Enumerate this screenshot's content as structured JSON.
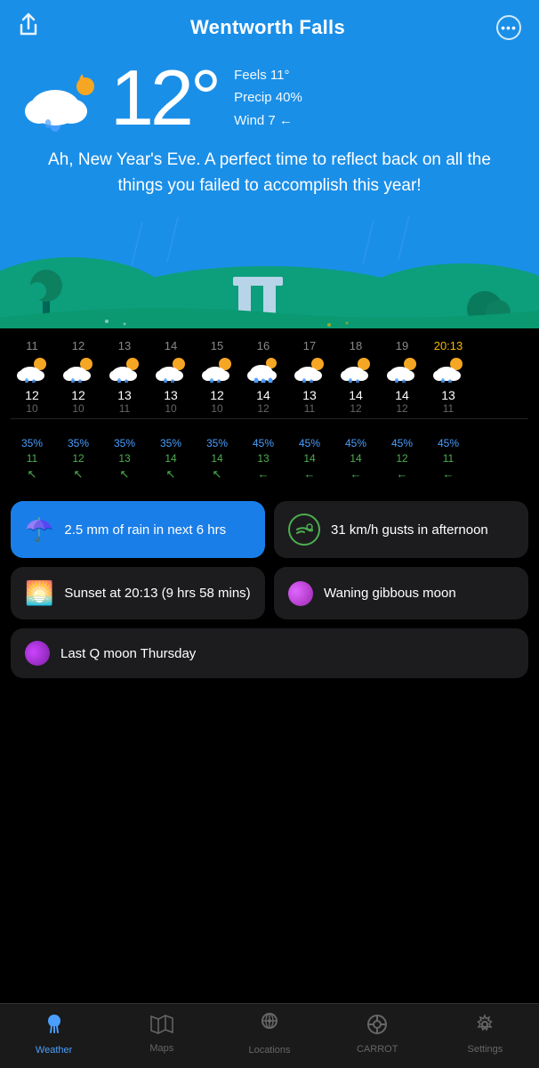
{
  "header": {
    "title": "Wentworth Falls",
    "share_label": "share",
    "more_label": "more"
  },
  "current": {
    "temperature": "12°",
    "feels_like": "Feels 11°",
    "precip": "Precip 40%",
    "wind": "Wind 7 ←",
    "message": "Ah, New Year's Eve. A perfect time to reflect back on all the things you failed to accomplish this year!"
  },
  "hourly": {
    "hours": [
      {
        "label": "11",
        "icon": "🌦",
        "high": "12",
        "low": "10"
      },
      {
        "label": "12",
        "icon": "🌦",
        "high": "12",
        "low": "10"
      },
      {
        "label": "13",
        "icon": "🌦",
        "high": "13",
        "low": "11"
      },
      {
        "label": "14",
        "icon": "🌦",
        "high": "13",
        "low": "10"
      },
      {
        "label": "15",
        "icon": "🌦",
        "high": "12",
        "low": "10"
      },
      {
        "label": "16",
        "icon": "🌧",
        "high": "14",
        "low": "12"
      },
      {
        "label": "17",
        "icon": "🌦",
        "high": "13",
        "low": "11"
      },
      {
        "label": "18",
        "icon": "🌦",
        "high": "14",
        "low": "12"
      },
      {
        "label": "19",
        "icon": "🌦",
        "high": "14",
        "low": "12"
      },
      {
        "label": "20",
        "icon": "🌦",
        "high": "13",
        "low": "11",
        "current": true,
        "current_label": "20:13"
      }
    ]
  },
  "details": [
    {
      "precip": "35%",
      "wind": "11",
      "dir": "↖"
    },
    {
      "precip": "35%",
      "wind": "12",
      "dir": "↖"
    },
    {
      "precip": "35%",
      "wind": "13",
      "dir": "↖"
    },
    {
      "precip": "35%",
      "wind": "14",
      "dir": "↖"
    },
    {
      "precip": "35%",
      "wind": "14",
      "dir": "↖"
    },
    {
      "precip": "45%",
      "wind": "13",
      "dir": "←"
    },
    {
      "precip": "45%",
      "wind": "14",
      "dir": "←"
    },
    {
      "precip": "45%",
      "wind": "14",
      "dir": "←"
    },
    {
      "precip": "45%",
      "wind": "12",
      "dir": "←"
    },
    {
      "precip": "45%",
      "wind": "11",
      "dir": "←"
    }
  ],
  "cards": [
    {
      "id": "rain",
      "icon": "☂️",
      "text": "2.5 mm of rain in next 6 hrs",
      "blue": true
    },
    {
      "id": "wind",
      "icon": "wind",
      "text": "31 km/h gusts in afternoon",
      "blue": false
    },
    {
      "id": "sunset",
      "icon": "🌅",
      "text": "Sunset at 20:13\n(9 hrs 58 mins)",
      "blue": false
    },
    {
      "id": "moon",
      "icon": "moon",
      "text": "Waning gibbous moon",
      "blue": false
    },
    {
      "id": "lastq",
      "icon": "lastq",
      "text": "Last Q moon Thursday",
      "blue": false,
      "full": true
    }
  ],
  "nav": {
    "items": [
      {
        "id": "weather",
        "icon": "💧",
        "label": "Weather",
        "active": true
      },
      {
        "id": "maps",
        "icon": "🗺",
        "label": "Maps",
        "active": false
      },
      {
        "id": "locations",
        "icon": "🔍",
        "label": "Locations",
        "active": false
      },
      {
        "id": "carrot",
        "icon": "🎯",
        "label": "CARROT",
        "active": false
      },
      {
        "id": "settings",
        "icon": "⚙️",
        "label": "Settings",
        "active": false
      }
    ]
  }
}
